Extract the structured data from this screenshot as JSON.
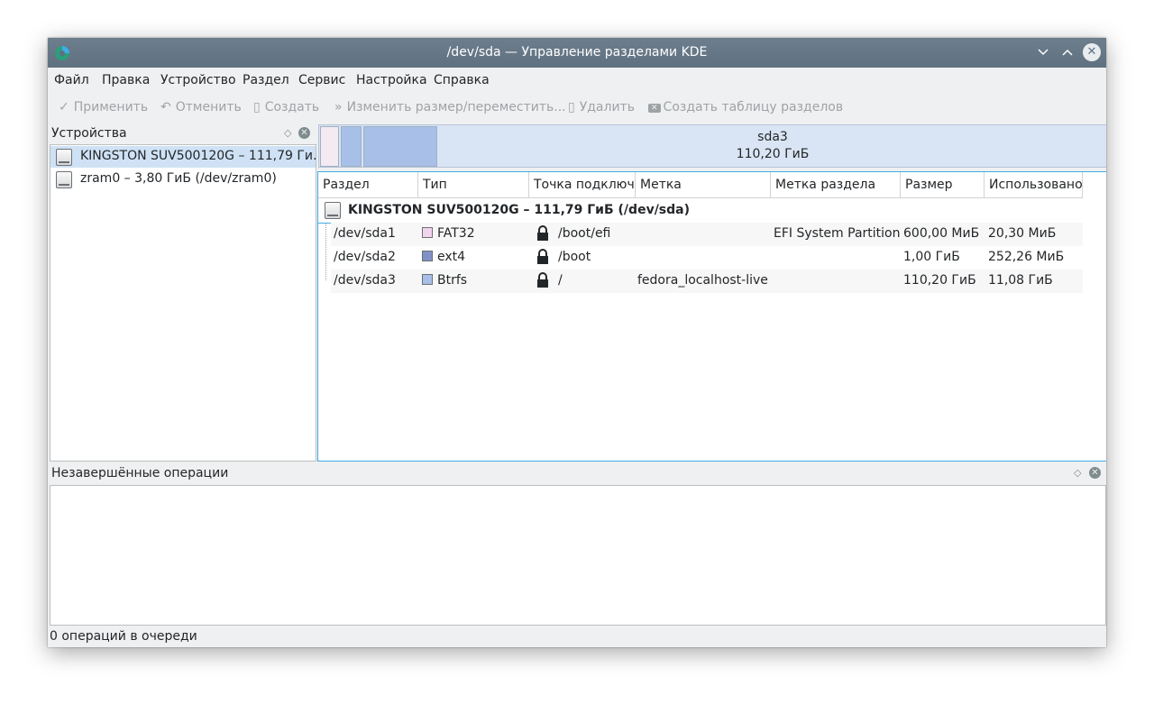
{
  "window": {
    "title": "/dev/sda — Управление разделами KDE",
    "controls": [
      "chevron-down-icon",
      "chevron-up-icon",
      "close-icon"
    ]
  },
  "menu": [
    "Файл",
    "Правка",
    "Устройство",
    "Раздел",
    "Сервис",
    "Настройка",
    "Справка"
  ],
  "toolbar": {
    "apply": "Применить",
    "undo": "Отменить",
    "create": "Создать",
    "resize": "Изменить размер/переместить...",
    "delete": "Удалить",
    "create_table": "Создать таблицу разделов"
  },
  "devices": {
    "title": "Устройства",
    "items": [
      {
        "label": "KINGSTON SUV500120G – 111,79 Ги…",
        "selected": true
      },
      {
        "label": "zram0 – 3,80 ГиБ (/dev/zram0)",
        "selected": false
      }
    ]
  },
  "partition_bar": {
    "selected_name": "sda3",
    "selected_size": "110,20 ГиБ"
  },
  "table": {
    "columns": [
      "Раздел",
      "Тип",
      "Точка подключе",
      "Метка",
      "Метка раздела",
      "Размер",
      "Использовано"
    ],
    "device_row": "KINGSTON SUV500120G – 111,79 ГиБ (/dev/sda)",
    "rows": [
      {
        "partition": "/dev/sda1",
        "type": "FAT32",
        "type_color": "#f1d5ec",
        "mount": "/boot/efi",
        "locked": true,
        "label": "",
        "part_label": "EFI System Partition",
        "size": "600,00 МиБ",
        "used": "20,30 МиБ"
      },
      {
        "partition": "/dev/sda2",
        "type": "ext4",
        "type_color": "#7f92c8",
        "mount": "/boot",
        "locked": true,
        "label": "",
        "part_label": "",
        "size": "1,00 ГиБ",
        "used": "252,26 МиБ"
      },
      {
        "partition": "/dev/sda3",
        "type": "Btrfs",
        "type_color": "#a8bfe8",
        "mount": "/",
        "locked": true,
        "label": "fedora_localhost-live",
        "part_label": "",
        "size": "110,20 ГиБ",
        "used": "11,08 ГиБ"
      }
    ]
  },
  "pending": {
    "title": "Незавершённые операции"
  },
  "status": "0 операций в очереди"
}
